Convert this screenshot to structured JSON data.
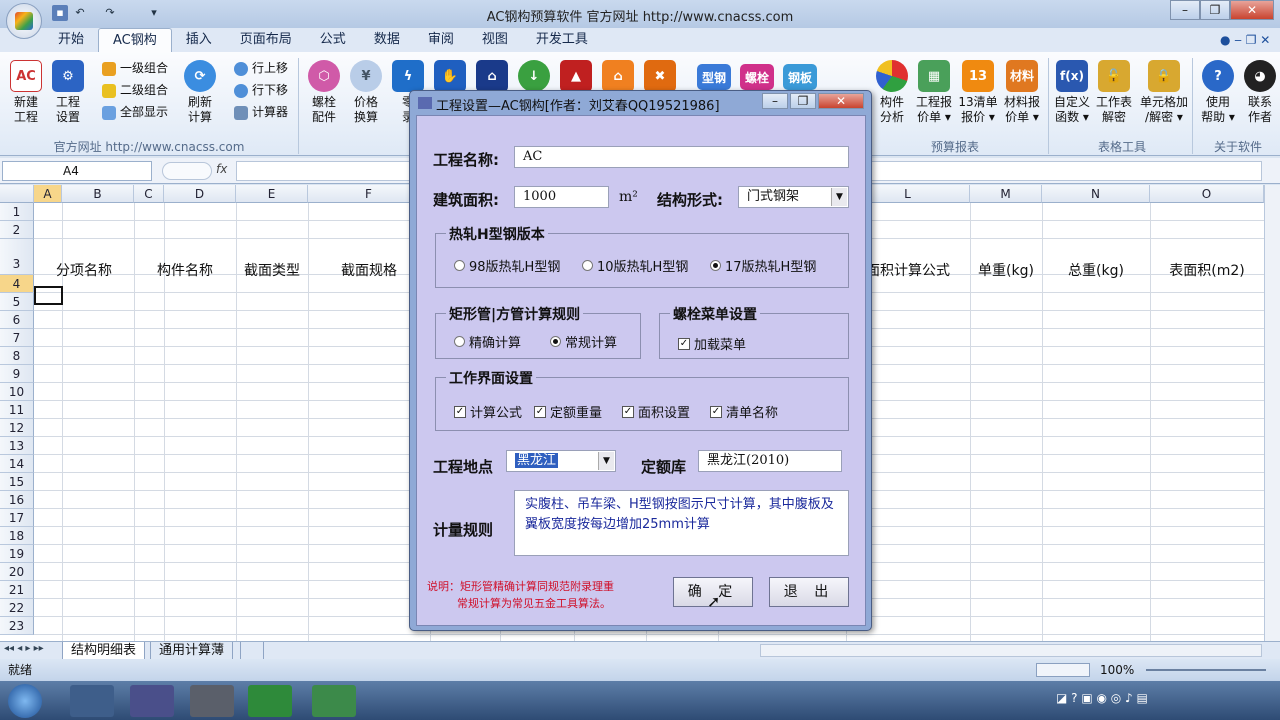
{
  "window": {
    "title": "AC钢构预算软件  官方网址 http://www.cnacss.com"
  },
  "menu": {
    "tabs": [
      "开始",
      "AC钢构",
      "插入",
      "页面布局",
      "公式",
      "数据",
      "审阅",
      "视图",
      "开发工具"
    ],
    "active": "AC钢构"
  },
  "ribbon": {
    "b1": "新建\n工程",
    "b2": "工程\n设置",
    "s1": "一级组合",
    "s2": "二级组合",
    "s3": "全部显示",
    "b3": "刷新\n计算",
    "s4": "行上移",
    "s5": "行下移",
    "s6": "计算器",
    "b4": "螺栓\n配件",
    "b5": "价格\n换算",
    "b6": "零\n录",
    "site_label": "官方网址 http://www.cnacss.com",
    "r1": "型钢",
    "r2": "螺栓",
    "r3": "钢板",
    "b7": "构件\n分析",
    "b8": "工程报\n价单 ▾",
    "b9": "13清单\n报价 ▾",
    "b10": "材料报\n价单 ▾",
    "g_report": "预算报表",
    "b11": "自定义\n函数 ▾",
    "b12": "工作表\n解密",
    "b13": "单元格加\n/解密 ▾",
    "g_table": "表格工具",
    "b14": "使用\n帮助 ▾",
    "b15": "联系\n作者",
    "g_about": "关于软件",
    "i13": "13",
    "imat": "材料",
    "ifx": "f(x)",
    "ihelp": "?"
  },
  "formula": {
    "cell": "A4",
    "fx": "fx"
  },
  "sheet": {
    "cols": [
      "A",
      "B",
      "C",
      "D",
      "E",
      "F",
      "",
      "",
      "",
      "",
      "",
      "",
      "L",
      "M",
      "N",
      "O"
    ],
    "headers": {
      "h1": "分项名称",
      "h2": "构件名称",
      "h3": "截面类型",
      "h4": "截面规格",
      "h5": "面积计算公式",
      "h6": "单重(kg)",
      "h7": "总重(kg)",
      "h8": "表面积(m2)"
    },
    "rows": [
      "1",
      "2",
      "3",
      "4",
      "5",
      "6",
      "7",
      "8",
      "9",
      "10",
      "11",
      "12",
      "13",
      "14",
      "15",
      "16",
      "17",
      "18",
      "19",
      "20",
      "21",
      "22",
      "23"
    ],
    "tabs": [
      "结构明细表",
      "通用计算薄"
    ]
  },
  "status": {
    "text": "就绪",
    "zoom": "100%"
  },
  "dialog": {
    "title": "工程设置—AC钢构[作者：刘艾春QQ19521986]",
    "name_label": "工程名称:",
    "name_value": "AC",
    "area_label": "建筑面积:",
    "area_value": "1000",
    "area_unit": "m²",
    "struct_label": "结构形式:",
    "struct_value": "门式钢架",
    "hsteel_title": "热轧H型钢版本",
    "hsteel_opts": [
      "98版热轧H型钢",
      "10版热轧H型钢",
      "17版热轧H型钢"
    ],
    "hsteel_selected": 2,
    "rect_title": "矩形管|方管计算规则",
    "rect_opts": [
      "精确计算",
      "常规计算"
    ],
    "rect_selected": 1,
    "bolt_title": "螺栓菜单设置",
    "bolt_chk": "加载菜单",
    "ui_title": "工作界面设置",
    "ui_chks": [
      "计算公式",
      "定额重量",
      "面积设置",
      "清单名称"
    ],
    "loc_label": "工程地点",
    "loc_value": "黑龙江",
    "quota_label": "定额库",
    "quota_value": "黑龙江(2010)",
    "rule_label": "计量规则",
    "rule_text": "实腹柱、吊车梁、H型钢按图示尺寸计算，其中腹板及翼板宽度按每边增加25mm计算",
    "note1": "说明：矩形管精确计算同规范附录理重",
    "note2": "常规计算为常见五金工具算法。",
    "ok": "确 定",
    "exit": "退 出"
  }
}
